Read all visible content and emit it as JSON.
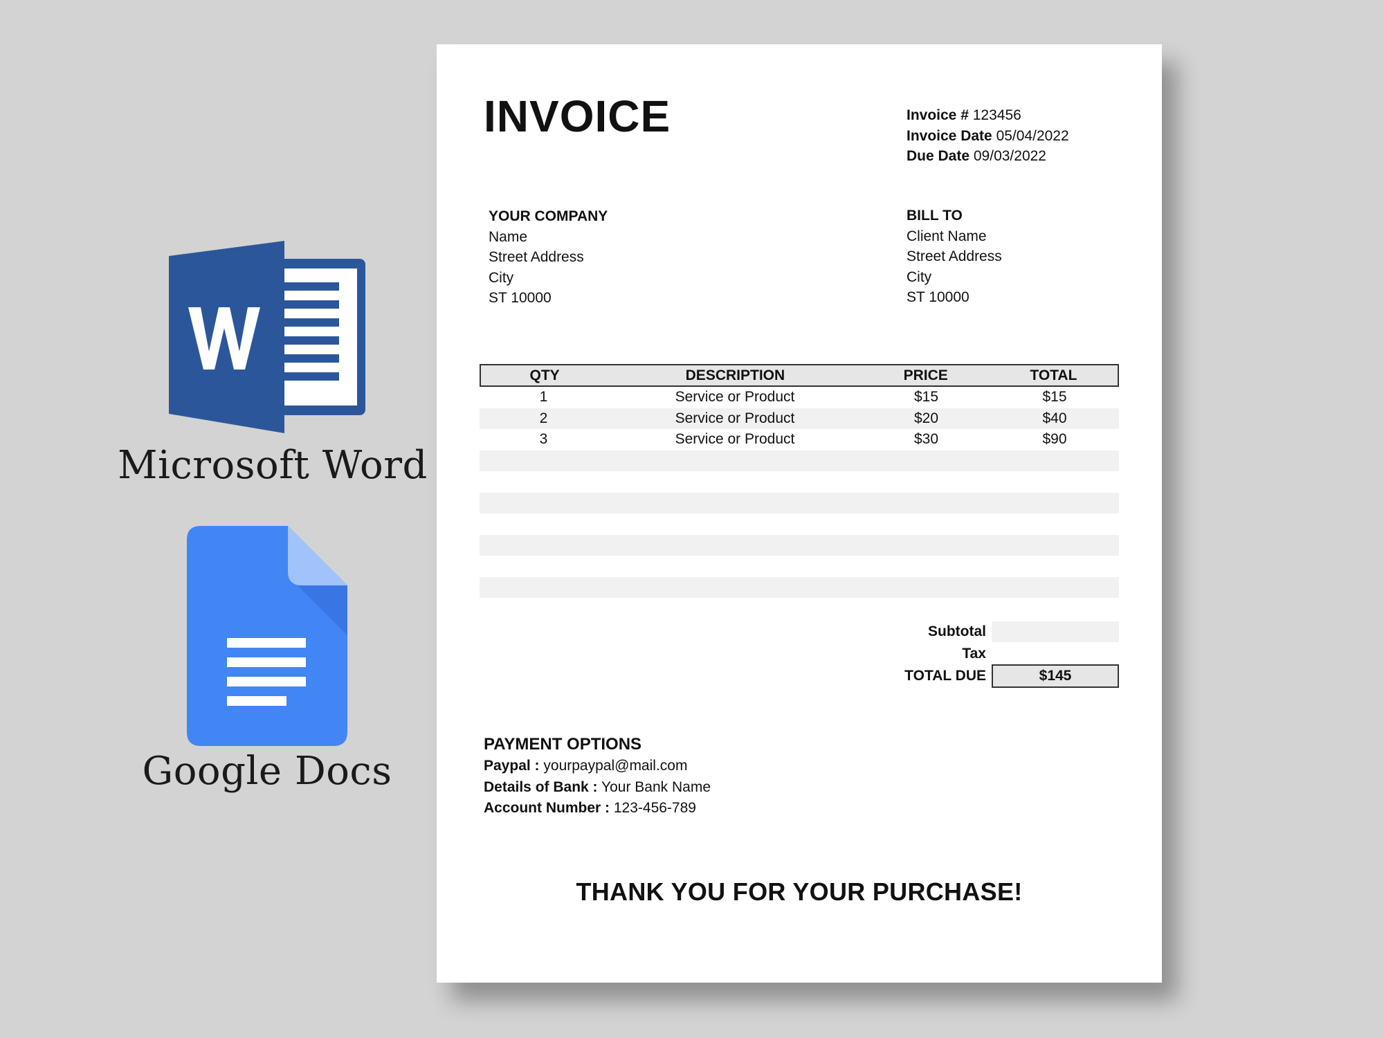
{
  "brands": {
    "word": {
      "label": "Microsoft Word",
      "icon": "microsoft-word-icon",
      "color": "#2b579a"
    },
    "docs": {
      "label": "Google Docs",
      "icon": "google-docs-icon",
      "color": "#4285f4"
    }
  },
  "invoice": {
    "title": "INVOICE",
    "meta": {
      "number_label": "Invoice #",
      "number": "123456",
      "date_label": "Invoice Date",
      "date": "05/04/2022",
      "due_label": "Due Date",
      "due": "09/03/2022"
    },
    "company": {
      "heading": "YOUR COMPANY",
      "lines": [
        "Name",
        "Street Address",
        "City",
        "ST 10000"
      ]
    },
    "bill_to": {
      "heading": "BILL TO",
      "lines": [
        "Client Name",
        "Street Address",
        "City",
        "ST 10000"
      ]
    },
    "table": {
      "headers": [
        "QTY",
        "DESCRIPTION",
        "PRICE",
        "TOTAL"
      ],
      "rows": [
        [
          "1",
          "Service or Product",
          "$15",
          "$15"
        ],
        [
          "2",
          "Service or Product",
          "$20",
          "$40"
        ],
        [
          "3",
          "Service or Product",
          "$30",
          "$90"
        ],
        [
          "",
          "",
          "",
          ""
        ],
        [
          "",
          "",
          "",
          ""
        ],
        [
          "",
          "",
          "",
          ""
        ],
        [
          "",
          "",
          "",
          ""
        ],
        [
          "",
          "",
          "",
          ""
        ],
        [
          "",
          "",
          "",
          ""
        ],
        [
          "",
          "",
          "",
          ""
        ]
      ]
    },
    "totals": {
      "subtotal_label": "Subtotal",
      "subtotal": "",
      "tax_label": "Tax",
      "tax": "",
      "due_label": "TOTAL DUE",
      "due": "$145"
    },
    "payment": {
      "heading": "PAYMENT OPTIONS",
      "paypal_label": "Paypal :",
      "paypal": "yourpaypal@mail.com",
      "bank_label": "Details of Bank :",
      "bank": "Your Bank Name",
      "account_label": "Account Number :",
      "account": "123-456-789"
    },
    "thanks": "THANK YOU FOR YOUR PURCHASE!"
  }
}
